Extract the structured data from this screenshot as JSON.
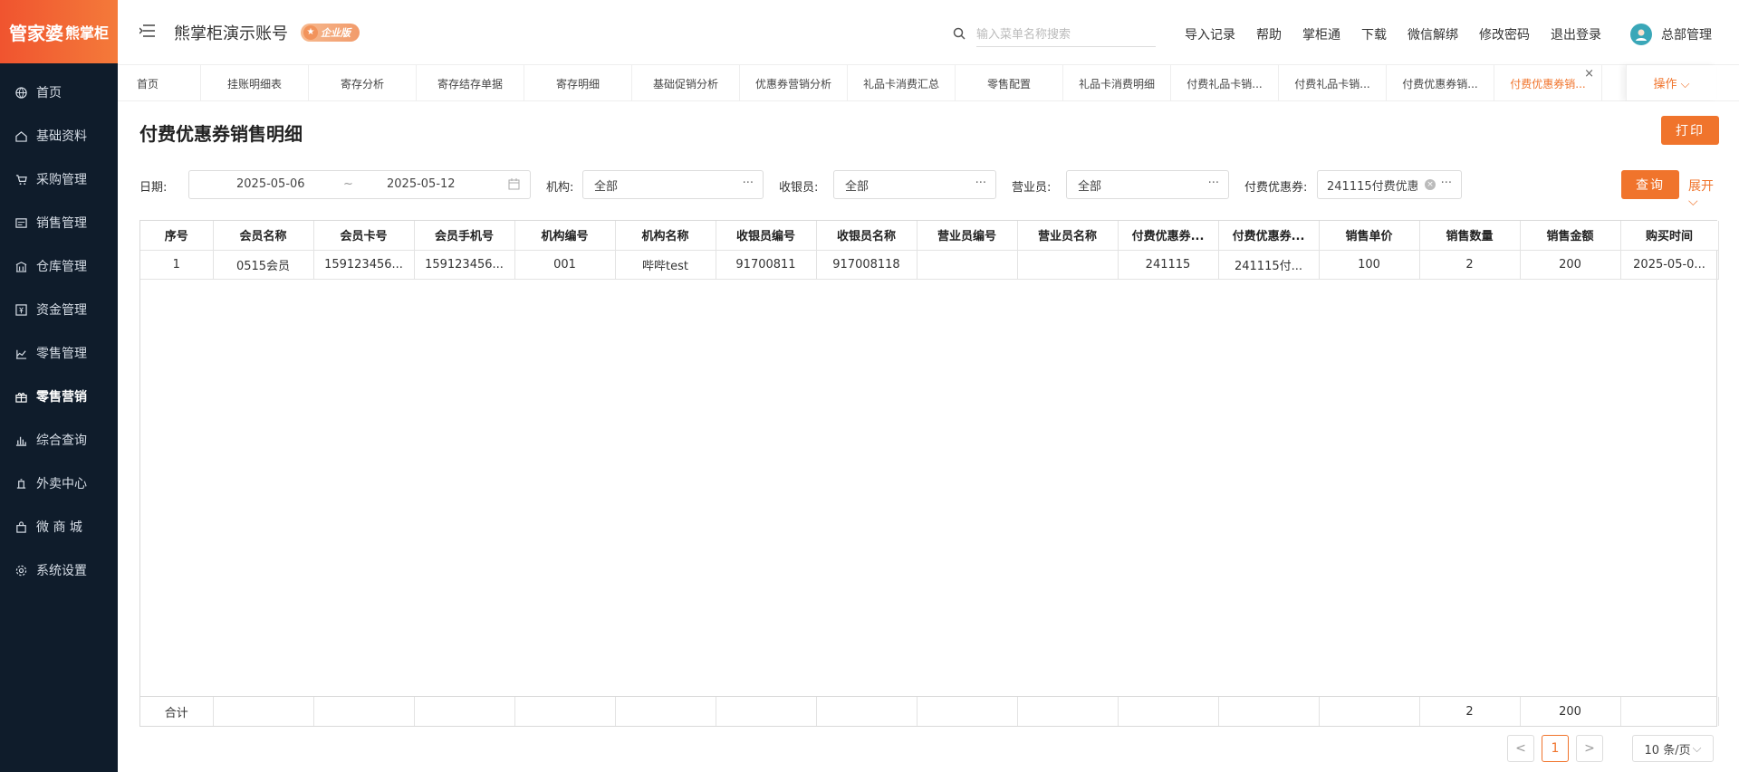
{
  "logo": {
    "text": "管家婆",
    "sub": "熊掌柜"
  },
  "sidebar": {
    "items": [
      {
        "label": "首页",
        "icon": "globe-icon"
      },
      {
        "label": "基础资料",
        "icon": "home-icon"
      },
      {
        "label": "采购管理",
        "icon": "cart-icon"
      },
      {
        "label": "销售管理",
        "icon": "receipt-icon"
      },
      {
        "label": "仓库管理",
        "icon": "warehouse-icon"
      },
      {
        "label": "资金管理",
        "icon": "money-icon"
      },
      {
        "label": "零售管理",
        "icon": "chart-icon"
      },
      {
        "label": "零售营销",
        "icon": "gift-icon"
      },
      {
        "label": "综合查询",
        "icon": "bar-chart-icon"
      },
      {
        "label": "外卖中心",
        "icon": "delivery-icon"
      },
      {
        "label": "微 商 城",
        "icon": "bag-icon"
      },
      {
        "label": "系统设置",
        "icon": "gear-icon"
      }
    ]
  },
  "header": {
    "account_title": "熊掌柜演示账号",
    "edition_badge": "企业版",
    "search_placeholder": "输入菜单名称搜索",
    "links": [
      "导入记录",
      "帮助",
      "掌柜通",
      "下载",
      "微信解绑",
      "修改密码",
      "退出登录"
    ],
    "user_name": "总部管理"
  },
  "tabs": {
    "items": [
      "首页",
      "挂账明细表",
      "寄存分析",
      "寄存结存单据",
      "寄存明细",
      "基础促销分析",
      "优惠券营销分析",
      "礼品卡消费汇总",
      "零售配置",
      "礼品卡消费明细",
      "付费礼品卡销...",
      "付费礼品卡销...",
      "付费优惠券销...",
      "付费优惠券销..."
    ],
    "active_index": 13,
    "more_label": "操作 ⌵"
  },
  "page": {
    "title": "付费优惠券销售明细",
    "print_label": "打印",
    "query_label": "查询",
    "expand_label": "展开"
  },
  "filters": {
    "date_label": "日期:",
    "date_start": "2025-05-06",
    "date_sep": "~",
    "date_end": "2025-05-12",
    "org_label": "机构:",
    "org_value": "全部",
    "cashier_label": "收银员:",
    "cashier_value": "全部",
    "salesman_label": "营业员:",
    "salesman_value": "全部",
    "coupon_label": "付费优惠券:",
    "coupon_value": "241115付费优惠"
  },
  "table": {
    "columns": [
      "序号",
      "会员名称",
      "会员卡号",
      "会员手机号",
      "机构编号",
      "机构名称",
      "收银员编号",
      "收银员名称",
      "营业员编号",
      "营业员名称",
      "付费优惠券...",
      "付费优惠券...",
      "销售单价",
      "销售数量",
      "销售金额",
      "购买时间"
    ],
    "rows": [
      [
        "1",
        "0515会员",
        "159123456...",
        "159123456...",
        "001",
        "哔哔test",
        "91700811",
        "917008118",
        "",
        "",
        "241115",
        "241115付...",
        "100",
        "2",
        "200",
        "2025-05-0..."
      ]
    ],
    "footer": [
      "合计",
      "",
      "",
      "",
      "",
      "",
      "",
      "",
      "",
      "",
      "",
      "",
      "",
      "2",
      "200",
      ""
    ]
  },
  "pagination": {
    "prev": "<",
    "current": "1",
    "next": ">",
    "page_size": "10 条/页"
  },
  "colors": {
    "accent": "#f0742c",
    "sidebar_bg": "#0f1c2b"
  }
}
